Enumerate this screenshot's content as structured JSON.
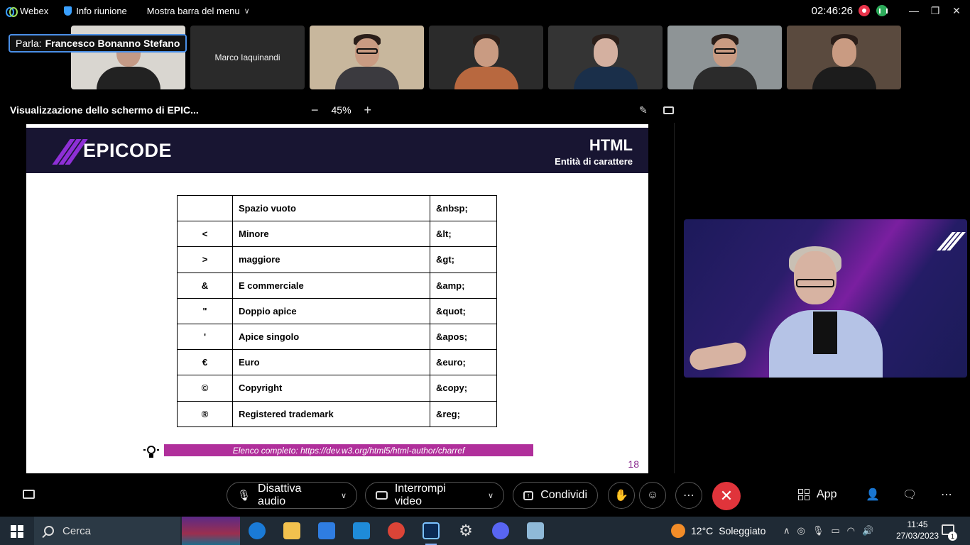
{
  "topbar": {
    "app_name": "Webex",
    "meeting_info": "Info riunione",
    "menu_toggle": "Mostra barra del menu",
    "clock": "02:46:26"
  },
  "speaker": {
    "prefix": "Parla:",
    "name": "Francesco Bonanno Stefano"
  },
  "participants": [
    {
      "name": "Marco Iaquinandi"
    }
  ],
  "share": {
    "title": "Visualizzazione dello schermo di EPIC...",
    "zoom": "45%"
  },
  "slide": {
    "brand": "EPICODE",
    "heading": "HTML",
    "subheading": "Entità di carattere",
    "rows": [
      {
        "symbol": "",
        "name": "Spazio vuoto",
        "entity": "&nbsp;"
      },
      {
        "symbol": "<",
        "name": "Minore",
        "entity": "&lt;"
      },
      {
        "symbol": ">",
        "name": "maggiore",
        "entity": "&gt;"
      },
      {
        "symbol": "&",
        "name": "E commerciale",
        "entity": "&amp;"
      },
      {
        "symbol": "\"",
        "name": "Doppio apice",
        "entity": "&quot;"
      },
      {
        "symbol": "'",
        "name": "Apice singolo",
        "entity": "&apos;"
      },
      {
        "symbol": "€",
        "name": "Euro",
        "entity": "&euro;"
      },
      {
        "symbol": "©",
        "name": "Copyright",
        "entity": "&copy;"
      },
      {
        "symbol": "®",
        "name": "Registered trademark",
        "entity": "&reg;"
      }
    ],
    "link_text": "Elenco completo: https://dev.w3.org/html5/html-author/charref",
    "page_number": "18"
  },
  "controls": {
    "mute_label": "Disattiva audio",
    "video_label": "Interrompi video",
    "share_label": "Condividi",
    "apps_label": "App"
  },
  "taskbar": {
    "search_label": "Cerca",
    "weather_temp": "12°C",
    "weather_desc": "Soleggiato",
    "time": "11:45",
    "date": "27/03/2023",
    "notif_count": "1"
  }
}
